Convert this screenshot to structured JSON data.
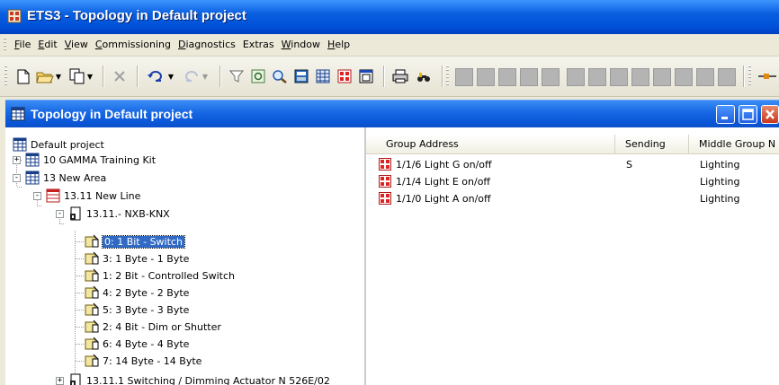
{
  "window": {
    "title": "ETS3 - Topology in Default project"
  },
  "menu": {
    "items": [
      {
        "accel": "F",
        "rest": "ile"
      },
      {
        "accel": "E",
        "rest": "dit"
      },
      {
        "accel": "V",
        "rest": "iew"
      },
      {
        "accel": "C",
        "rest": "ommissioning"
      },
      {
        "accel": "D",
        "rest": "iagnostics"
      },
      {
        "accel": "",
        "rest": "Extras"
      },
      {
        "accel": "W",
        "rest": "indow"
      },
      {
        "accel": "H",
        "rest": "elp"
      }
    ]
  },
  "toolbar": {
    "buttons": [
      "new-document-icon",
      "open-folder-icon",
      "copy-icon",
      "delete-icon",
      "undo-icon",
      "redo-icon",
      "filter-icon",
      "properties-icon",
      "search-icon",
      "ets-view-icon",
      "table-icon",
      "group-icon",
      "window-icon",
      "print-icon",
      "find-icon"
    ]
  },
  "inner_window": {
    "title": "Topology in Default project"
  },
  "tree": {
    "root": "Default project",
    "nodes": [
      {
        "label": "10 GAMMA Training Kit",
        "expander": "+"
      },
      {
        "label": "13 New Area",
        "expander": "-"
      },
      {
        "label": "13.11 New Line",
        "expander": "-"
      },
      {
        "label": "13.11.- NXB-KNX",
        "expander": "-"
      },
      {
        "label": "0: 1 Bit - Switch",
        "selected": true
      },
      {
        "label": "3: 1 Byte - 1 Byte"
      },
      {
        "label": "1: 2 Bit - Controlled Switch"
      },
      {
        "label": "4: 2 Byte - 2 Byte"
      },
      {
        "label": "5: 3 Byte - 3 Byte"
      },
      {
        "label": "2: 4 Bit - Dim or Shutter"
      },
      {
        "label": "6: 4 Byte - 4 Byte"
      },
      {
        "label": "7: 14 Byte - 14 Byte"
      },
      {
        "label": "13.11.1 Switching / Dimming Actuator N 526E/02",
        "expander": "+"
      }
    ]
  },
  "list": {
    "columns": [
      "Group Address",
      "Sending",
      "Middle Group N"
    ],
    "rows": [
      {
        "address": "1/1/6 Light G on/off",
        "sending": "S",
        "middle": "Lighting"
      },
      {
        "address": "1/1/4 Light E on/off",
        "sending": "",
        "middle": "Lighting"
      },
      {
        "address": "1/1/0 Light A on/off",
        "sending": "",
        "middle": "Lighting"
      }
    ]
  },
  "colors": {
    "titlebar": "#0a57d8",
    "selection": "#316ac5",
    "chrome": "#ece9d8"
  }
}
